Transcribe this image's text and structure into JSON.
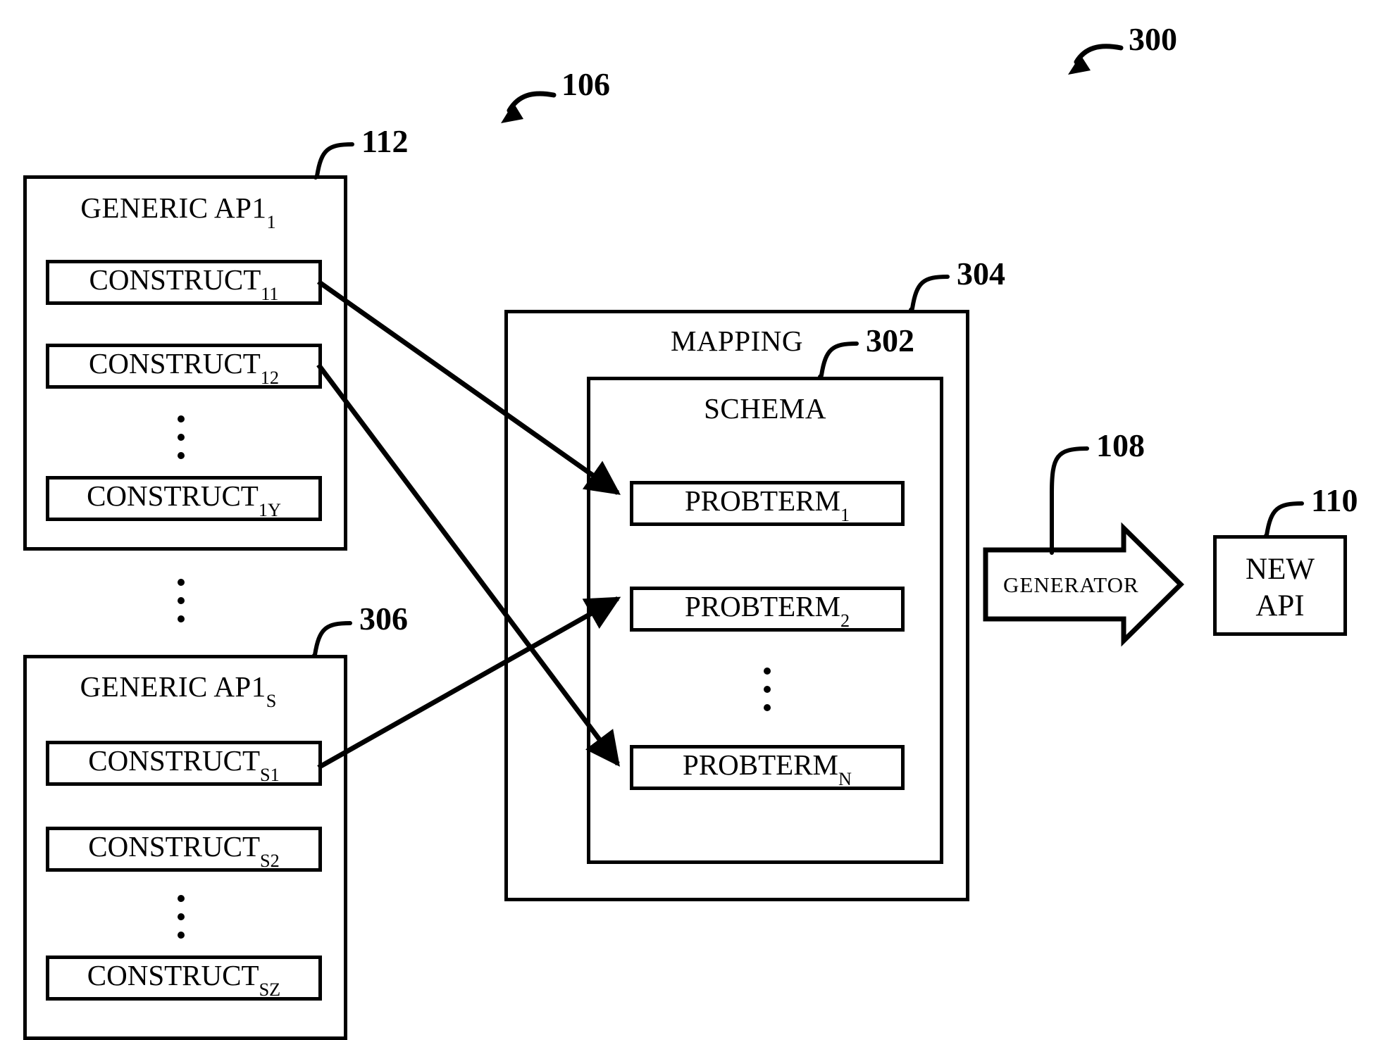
{
  "figure": {
    "figure_ref": "300",
    "group_ref": "106"
  },
  "generic_api_1": {
    "ref": "112",
    "title": "GENERIC AP1",
    "title_sub": "1",
    "constructs": [
      {
        "label": "CONSTRUCT",
        "sub": "11"
      },
      {
        "label": "CONSTRUCT",
        "sub": "12"
      },
      {
        "label": "CONSTRUCT",
        "sub": "1Y"
      }
    ],
    "ellipsis": "vertical-dots"
  },
  "generic_api_s": {
    "ref": "306",
    "title": "GENERIC AP1",
    "title_sub": "S",
    "constructs": [
      {
        "label": "CONSTRUCT",
        "sub": "S1"
      },
      {
        "label": "CONSTRUCT",
        "sub": "S2"
      },
      {
        "label": "CONSTRUCT",
        "sub": "SZ"
      }
    ],
    "ellipsis": "vertical-dots"
  },
  "between_apis_ellipsis": "vertical-dots",
  "mapping": {
    "ref": "304",
    "title": "MAPPING"
  },
  "schema": {
    "ref": "302",
    "title": "SCHEMA",
    "probterms": [
      {
        "label": "PROBTERM",
        "sub": "1"
      },
      {
        "label": "PROBTERM",
        "sub": "2"
      },
      {
        "label": "PROBTERM",
        "sub": "N"
      }
    ],
    "ellipsis": "vertical-dots"
  },
  "generator": {
    "ref": "108",
    "label": "GENERATOR"
  },
  "new_api": {
    "ref": "110",
    "line1": "NEW",
    "line2": "API"
  },
  "colors": {
    "stroke": "#000000",
    "background": "#ffffff"
  }
}
